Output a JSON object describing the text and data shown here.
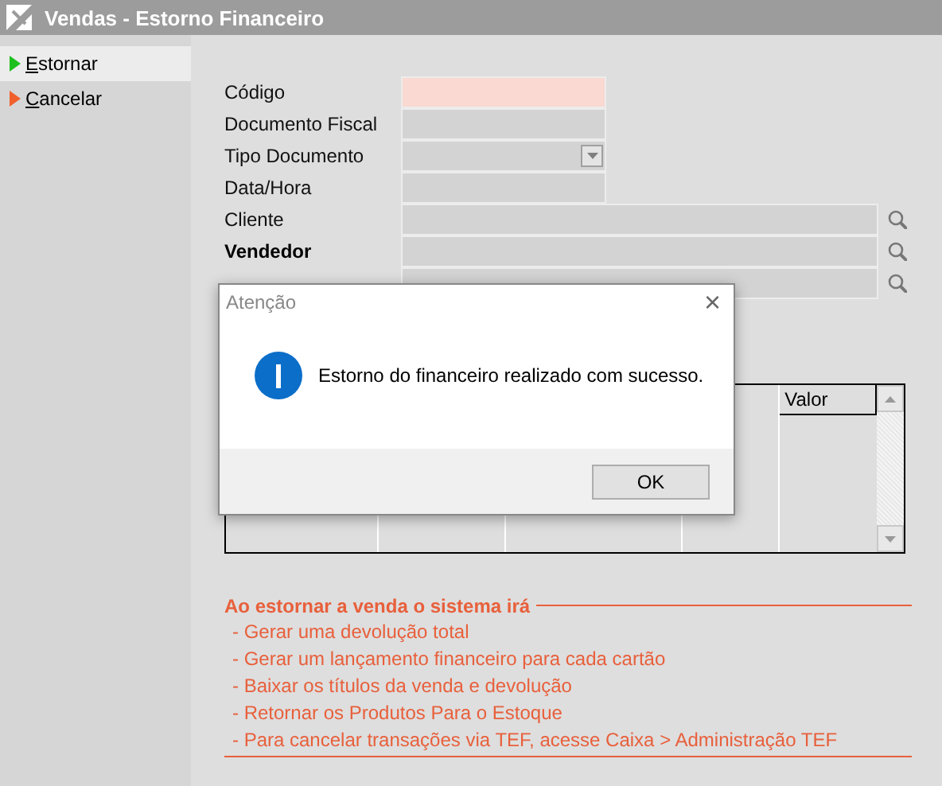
{
  "window": {
    "title": "Vendas - Estorno Financeiro"
  },
  "sidebar": {
    "items": [
      {
        "label": "Estornar",
        "selected": true,
        "color": "#1ec01e"
      },
      {
        "label": "Cancelar",
        "selected": false,
        "color": "#f0602c"
      }
    ]
  },
  "form": {
    "fields": [
      {
        "label": "Código",
        "kind": "text",
        "required": true,
        "emphasized": false
      },
      {
        "label": "Documento Fiscal",
        "kind": "text",
        "required": false,
        "emphasized": false
      },
      {
        "label": "Tipo Documento",
        "kind": "select",
        "required": false,
        "emphasized": false
      },
      {
        "label": "Data/Hora",
        "kind": "text",
        "required": false,
        "emphasized": false
      },
      {
        "label": "Cliente",
        "kind": "lookup",
        "required": false,
        "emphasized": false
      },
      {
        "label": "Vendedor",
        "kind": "lookup",
        "required": false,
        "emphasized": true
      },
      {
        "kind": "lookup",
        "required": false
      }
    ]
  },
  "grid": {
    "visible_column": "Valor"
  },
  "notes": {
    "heading": "Ao estornar a venda o sistema irá",
    "items": [
      "- Gerar uma devolução total",
      "- Gerar um lançamento financeiro para cada cartão",
      "- Baixar os títulos da venda e devolução",
      "- Retornar os Produtos Para o Estoque",
      "- Para cancelar transações via TEF, acesse Caixa > Administração TEF"
    ]
  },
  "dialog": {
    "title": "Atenção",
    "close": "×",
    "message": "Estorno do financeiro realizado com sucesso.",
    "buttons": [
      "OK"
    ]
  }
}
